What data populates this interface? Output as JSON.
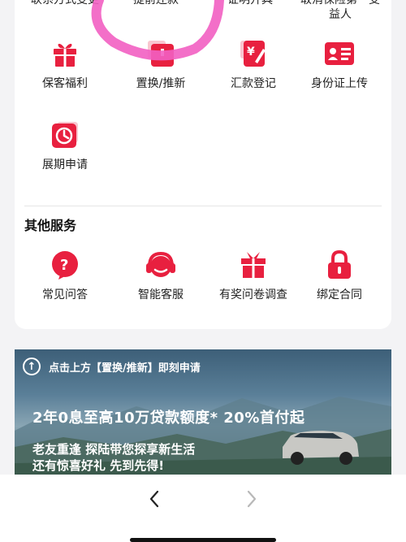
{
  "top_row": [
    {
      "label": "联系方式变更"
    },
    {
      "label": "提前还款"
    },
    {
      "label": "证明开具"
    },
    {
      "label_line1": "取消保险第一受",
      "label_line2": "益人"
    }
  ],
  "services": [
    {
      "label": "保客福利",
      "icon": "gift-icon"
    },
    {
      "label": "置换/推新",
      "icon": "exchange-icon"
    },
    {
      "label": "汇款登记",
      "icon": "remittance-icon"
    },
    {
      "label": "身份证上传",
      "icon": "id-card-icon"
    },
    {
      "label": "展期申请",
      "icon": "clock-icon"
    }
  ],
  "other_section": {
    "title": "其他服务",
    "items": [
      {
        "label": "常见问答",
        "icon": "question-icon"
      },
      {
        "label": "智能客服",
        "icon": "headset-icon"
      },
      {
        "label": "有奖问卷调查",
        "icon": "prize-gift-icon"
      },
      {
        "label": "绑定合同",
        "icon": "lock-icon"
      }
    ]
  },
  "banner": {
    "top_text": "点击上方【置换/推新】即刻申请",
    "headline": "2年0息至高10万贷款额度* 20%首付起",
    "sub_line1": "老友重逢 探陆带您探享新生活",
    "sub_line2": "还有惊喜好礼 先到先得!"
  },
  "colors": {
    "accent": "#e8203f",
    "annotation": "#f25fc2"
  }
}
